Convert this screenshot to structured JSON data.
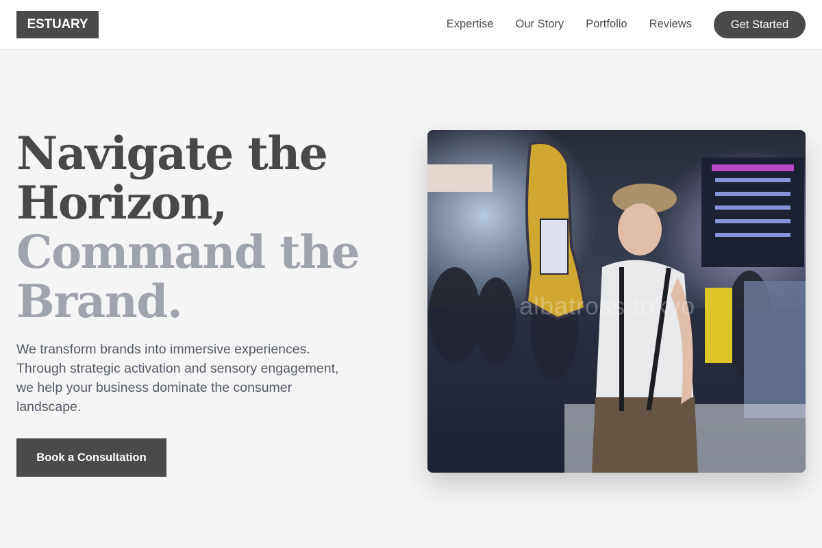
{
  "header": {
    "logo": "ESTUARY",
    "nav": [
      "Expertise",
      "Our Story",
      "Portfolio",
      "Reviews"
    ],
    "cta": "Get Started"
  },
  "hero": {
    "title_dark_1": "Navigate the",
    "title_dark_2": "Horizon,",
    "title_light_1": "Command the",
    "title_light_2": "Brand.",
    "subtitle": "We transform brands into immersive experiences. Through strategic activation and sensory engagement, we help your business dominate the consumer landscape.",
    "cta": "Book a Consultation",
    "image_watermark": "albatross.tokyo"
  },
  "colors": {
    "primary_dark": "#4a4a4a",
    "title_light": "#9ea3ad",
    "background": "#f5f5f5"
  }
}
